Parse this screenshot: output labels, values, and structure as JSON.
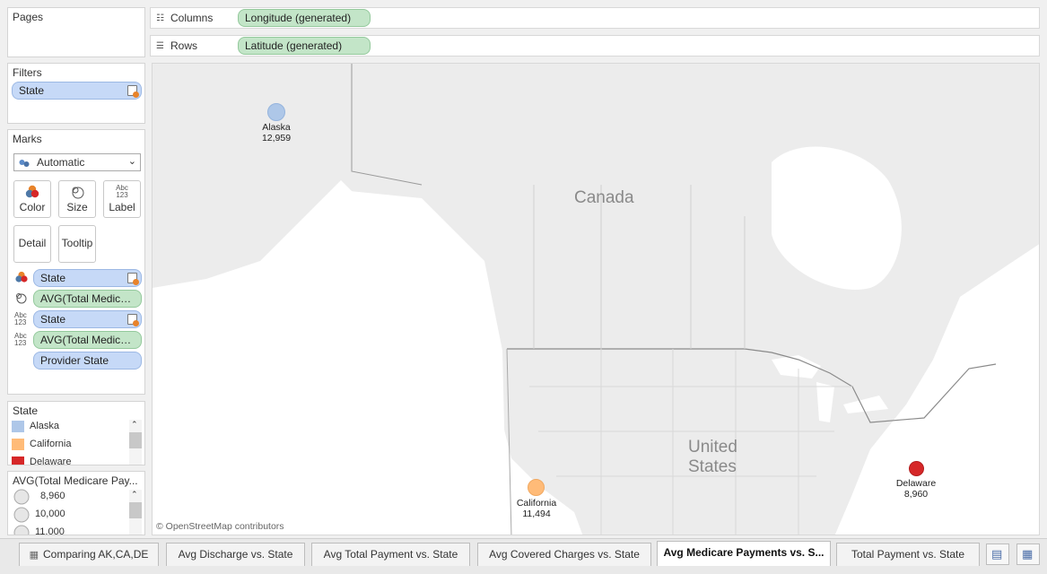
{
  "pages": {
    "title": "Pages"
  },
  "filters": {
    "title": "Filters",
    "pill": "State"
  },
  "marks": {
    "title": "Marks",
    "mark_type": "Automatic",
    "buttons": {
      "color": "Color",
      "size": "Size",
      "label": "Label",
      "detail": "Detail",
      "tooltip": "Tooltip"
    },
    "fields": [
      "State",
      "AVG(Total Medicar..",
      "State",
      "AVG(Total Medicar..",
      "Provider State"
    ]
  },
  "state_legend": {
    "title": "State",
    "items": [
      {
        "label": "Alaska",
        "color": "#aec7e8"
      },
      {
        "label": "California",
        "color": "#ffbb78"
      },
      {
        "label": "Delaware",
        "color": "#d62728"
      }
    ]
  },
  "size_legend": {
    "title": "AVG(Total Medicare Pay...",
    "items": [
      "8,960",
      "10,000",
      "11,000"
    ]
  },
  "shelves": {
    "columns_label": "Columns",
    "columns_pill": "Longitude (generated)",
    "rows_label": "Rows",
    "rows_pill": "Latitude (generated)"
  },
  "map": {
    "country_labels": {
      "canada": "Canada",
      "us_line1": "United",
      "us_line2": "States"
    },
    "attribution": "© OpenStreetMap contributors",
    "points": [
      {
        "state": "Alaska",
        "value": "12,959",
        "color": "#aec7e8"
      },
      {
        "state": "California",
        "value": "11,494",
        "color": "#ffbb78"
      },
      {
        "state": "Delaware",
        "value": "8,960",
        "color": "#d62728"
      }
    ]
  },
  "tabs": [
    {
      "label": "Comparing AK,CA,DE",
      "active": false
    },
    {
      "label": "Avg Discharge vs. State",
      "active": false
    },
    {
      "label": "Avg Total Payment vs. State",
      "active": false
    },
    {
      "label": "Avg Covered Charges vs. State",
      "active": false
    },
    {
      "label": "Avg Medicare Payments vs. S...",
      "active": true
    },
    {
      "label": "Total Payment vs. State",
      "active": false
    }
  ]
}
